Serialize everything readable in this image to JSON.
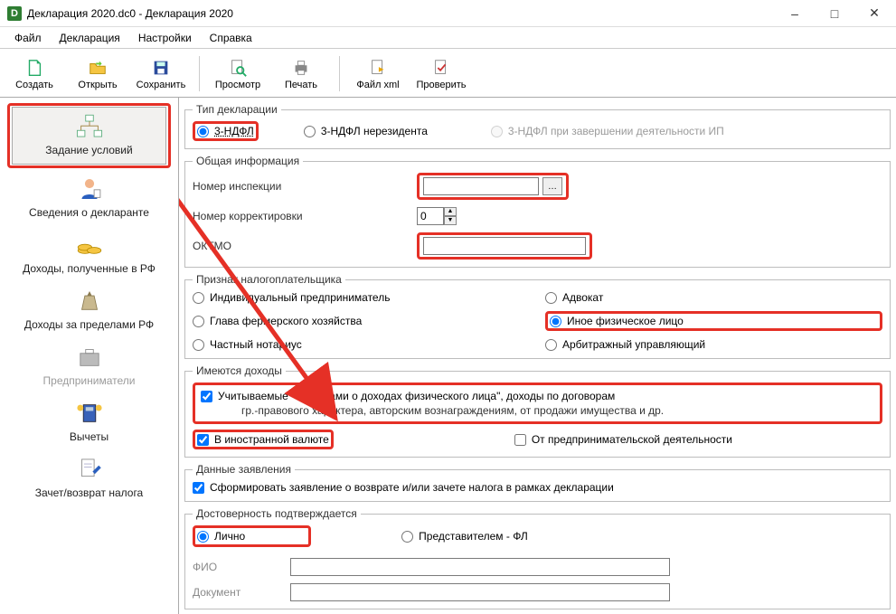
{
  "window": {
    "title": "Декларация 2020.dc0 - Декларация 2020"
  },
  "menu": {
    "file": "Файл",
    "declaration": "Декларация",
    "settings": "Настройки",
    "help": "Справка"
  },
  "toolbar": {
    "create": "Создать",
    "open": "Открыть",
    "save": "Сохранить",
    "preview": "Просмотр",
    "print": "Печать",
    "file_xml": "Файл xml",
    "check": "Проверить"
  },
  "sidebar": {
    "items": [
      {
        "label": "Задание условий"
      },
      {
        "label": "Сведения о декларанте"
      },
      {
        "label": "Доходы, полученные в РФ"
      },
      {
        "label": "Доходы за пределами РФ"
      },
      {
        "label": "Предприниматели"
      },
      {
        "label": "Вычеты"
      },
      {
        "label": "Зачет/возврат налога"
      }
    ]
  },
  "form": {
    "declaration_type": {
      "legend": "Тип декларации",
      "opt1": "3-НДФЛ",
      "opt2": "3-НДФЛ нерезидента",
      "opt3": "3-НДФЛ при завершении деятельности ИП"
    },
    "general_info": {
      "legend": "Общая информация",
      "inspection_label": "Номер инспекции",
      "inspection_value": "",
      "inspection_btn": "…",
      "correction_label": "Номер корректировки",
      "correction_value": "0",
      "oktmo_label": "ОКТМО",
      "oktmo_value": ""
    },
    "taxpayer_type": {
      "legend": "Признак налогоплательщика",
      "ip": "Индивидуальный предприниматель",
      "advokat": "Адвокат",
      "farmer": "Глава фермерского хозяйства",
      "other_person": "Иное физическое лицо",
      "notary": "Частный нотариус",
      "arbitr": "Арбитражный управляющий"
    },
    "have_income": {
      "legend": "Имеются доходы",
      "spravki_line1": "Учитываемые \"справками о доходах физического лица\", доходы по договорам",
      "spravki_line2": "гр.-правового характера, авторским вознаграждениям, от продажи имущества и др.",
      "foreign": "В иностранной валюте",
      "entrepr": "От предпринимательской деятельности"
    },
    "application_data": {
      "legend": "Данные заявления",
      "form_app": "Сформировать заявление о  возврате и/или зачете налога в рамках декларации"
    },
    "confirm": {
      "legend": "Достоверность подтверждается",
      "personally": "Лично",
      "representative": "Представителем - ФЛ",
      "fio_label": "ФИО",
      "doc_label": "Документ"
    }
  }
}
